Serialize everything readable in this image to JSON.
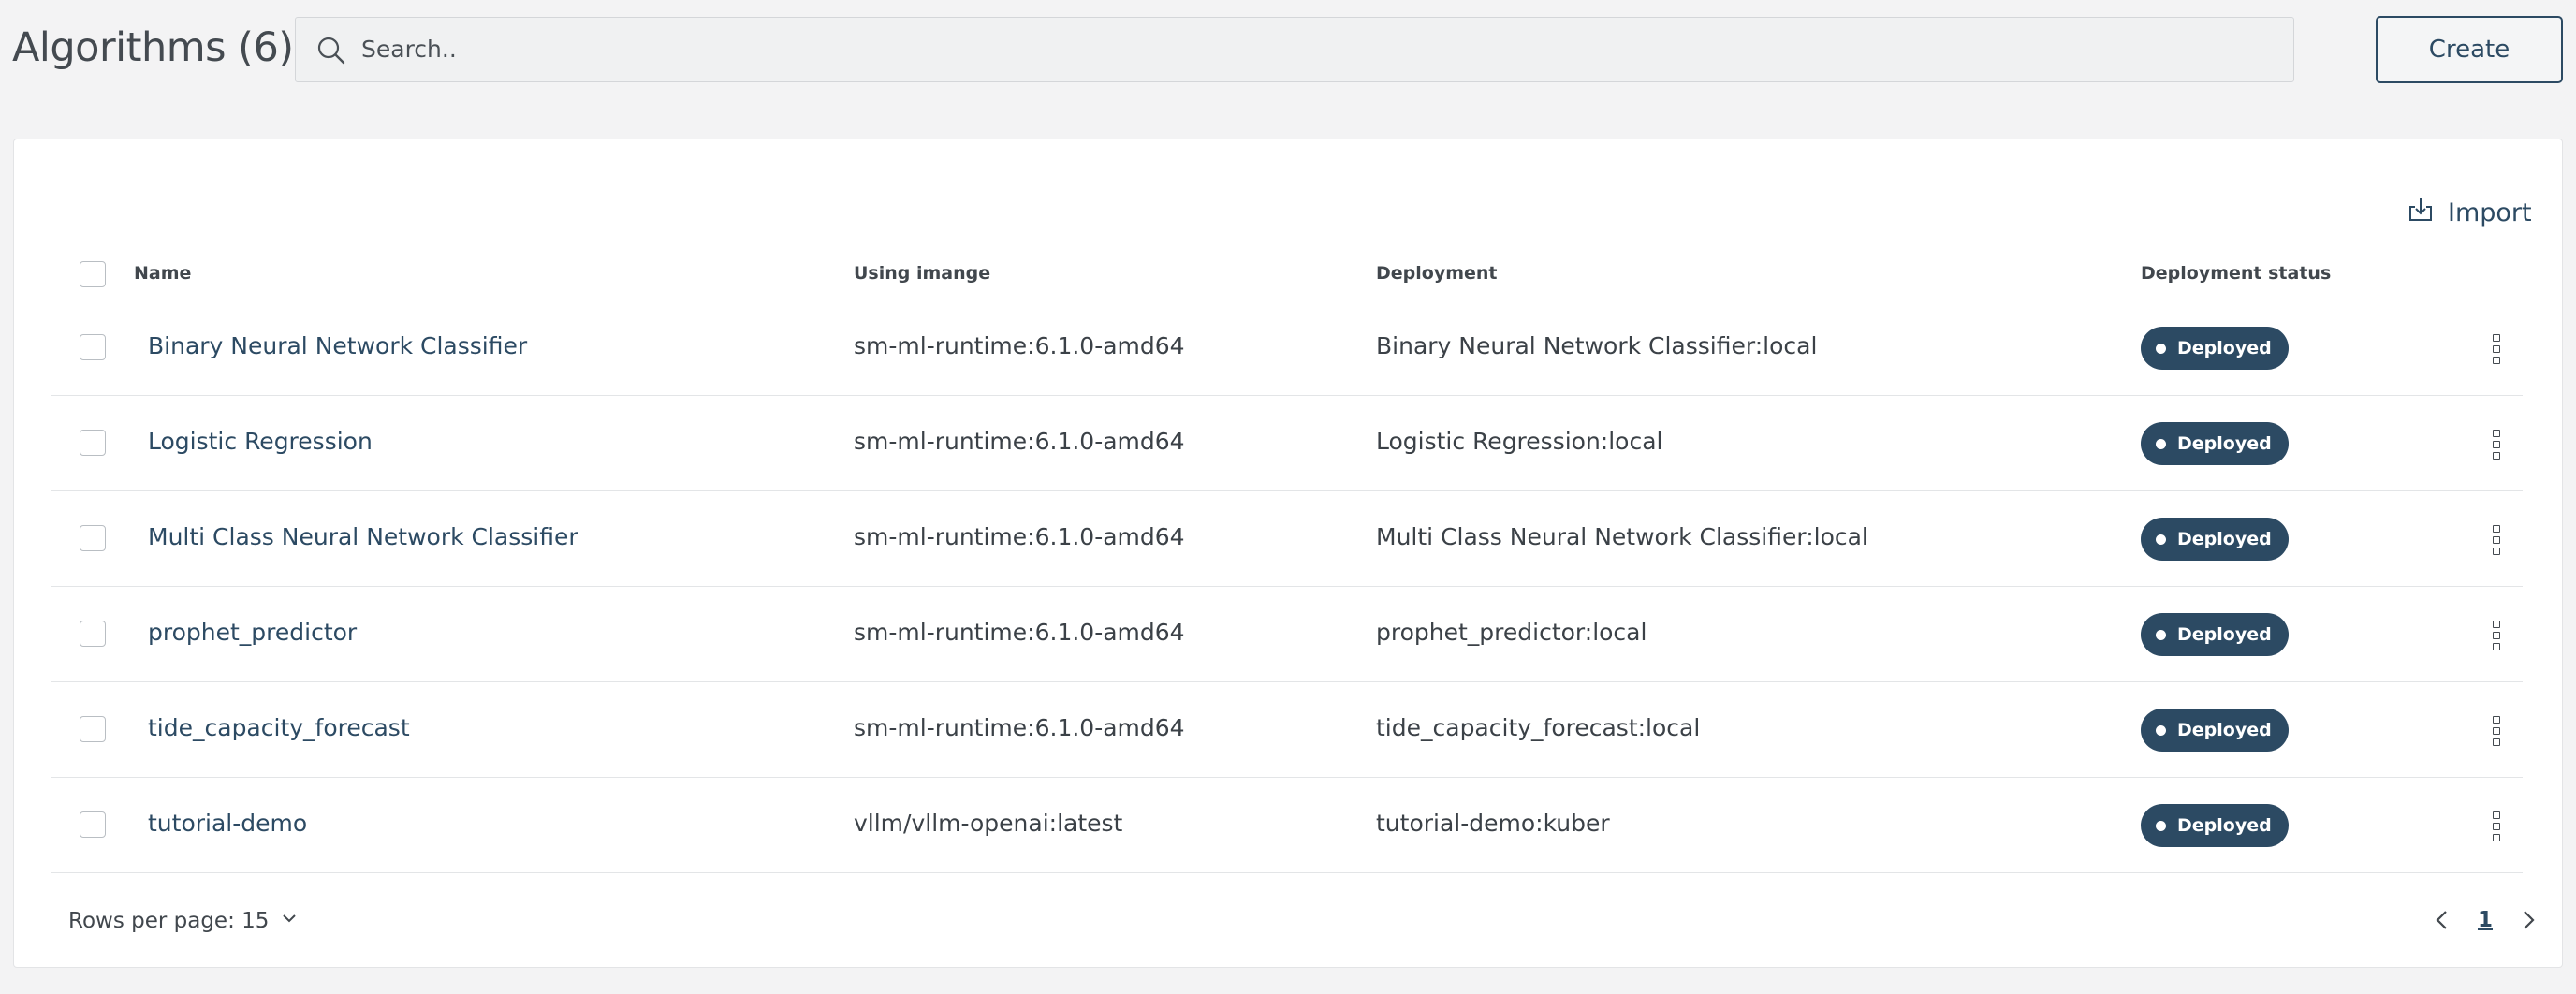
{
  "header": {
    "title": "Algorithms (6)",
    "search_placeholder": "Search..",
    "create_label": "Create"
  },
  "toolbar": {
    "import_label": "Import"
  },
  "table": {
    "columns": [
      "Name",
      "Using imange",
      "Deployment",
      "Deployment status"
    ],
    "rows": [
      {
        "name": "Binary Neural Network Classifier",
        "image": "sm-ml-runtime:6.1.0-amd64",
        "deployment": "Binary Neural Network Classifier:local",
        "status": "Deployed"
      },
      {
        "name": "Logistic Regression",
        "image": "sm-ml-runtime:6.1.0-amd64",
        "deployment": "Logistic Regression:local",
        "status": "Deployed"
      },
      {
        "name": "Multi Class Neural Network Classifier",
        "image": "sm-ml-runtime:6.1.0-amd64",
        "deployment": "Multi Class Neural Network Classifier:local",
        "status": "Deployed"
      },
      {
        "name": "prophet_predictor",
        "image": "sm-ml-runtime:6.1.0-amd64",
        "deployment": "prophet_predictor:local",
        "status": "Deployed"
      },
      {
        "name": "tide_capacity_forecast",
        "image": "sm-ml-runtime:6.1.0-amd64",
        "deployment": "tide_capacity_forecast:local",
        "status": "Deployed"
      },
      {
        "name": "tutorial-demo",
        "image": "vllm/vllm-openai:latest",
        "deployment": "tutorial-demo:kuber",
        "status": "Deployed"
      }
    ]
  },
  "footer": {
    "rows_per_page_label": "Rows per page: 15",
    "current_page": "1"
  },
  "colors": {
    "accent": "#2c4a63",
    "background": "#f3f3f4",
    "card": "#ffffff"
  },
  "icons": {
    "search": "search-icon",
    "import": "import-icon",
    "row_menu": "more-vertical-icon",
    "dropdown": "chevron-down-icon",
    "prev": "chevron-left-icon",
    "next": "chevron-right-icon"
  }
}
